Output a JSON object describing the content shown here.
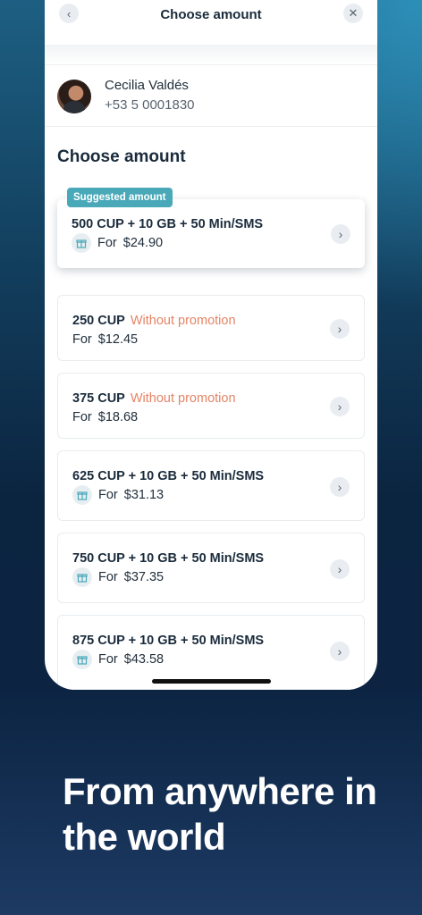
{
  "header": {
    "title": "Choose amount",
    "back_icon": "‹",
    "close_icon": "✕"
  },
  "recipient": {
    "name": "Cecilia Valdés",
    "phone": "+53 5 0001830"
  },
  "section_title": "Choose amount",
  "suggested": {
    "tag": "Suggested amount",
    "title": "500 CUP + 10 GB + 50 Min/SMS",
    "for_label": "For",
    "price": "$24.90"
  },
  "offers": [
    {
      "title": "250 CUP",
      "note": "Without promotion",
      "for_label": "For",
      "price": "$12.45"
    },
    {
      "title": "375 CUP",
      "note": "Without promotion",
      "for_label": "For",
      "price": "$18.68"
    },
    {
      "title": "625 CUP + 10 GB + 50 Min/SMS",
      "for_label": "For",
      "price": "$31.13"
    },
    {
      "title": "750 CUP + 10 GB + 50 Min/SMS",
      "for_label": "For",
      "price": "$37.35"
    },
    {
      "title": "875 CUP + 10 GB + 50 Min/SMS",
      "for_label": "For",
      "price": "$43.58"
    }
  ],
  "tagline": "From anywhere in the world",
  "colors": {
    "accent": "#4aa9b9",
    "promo": "#e58466",
    "text": "#1a2b3c"
  },
  "icons": {
    "gift": "gift-icon",
    "chevron": "chevron-right-icon"
  }
}
